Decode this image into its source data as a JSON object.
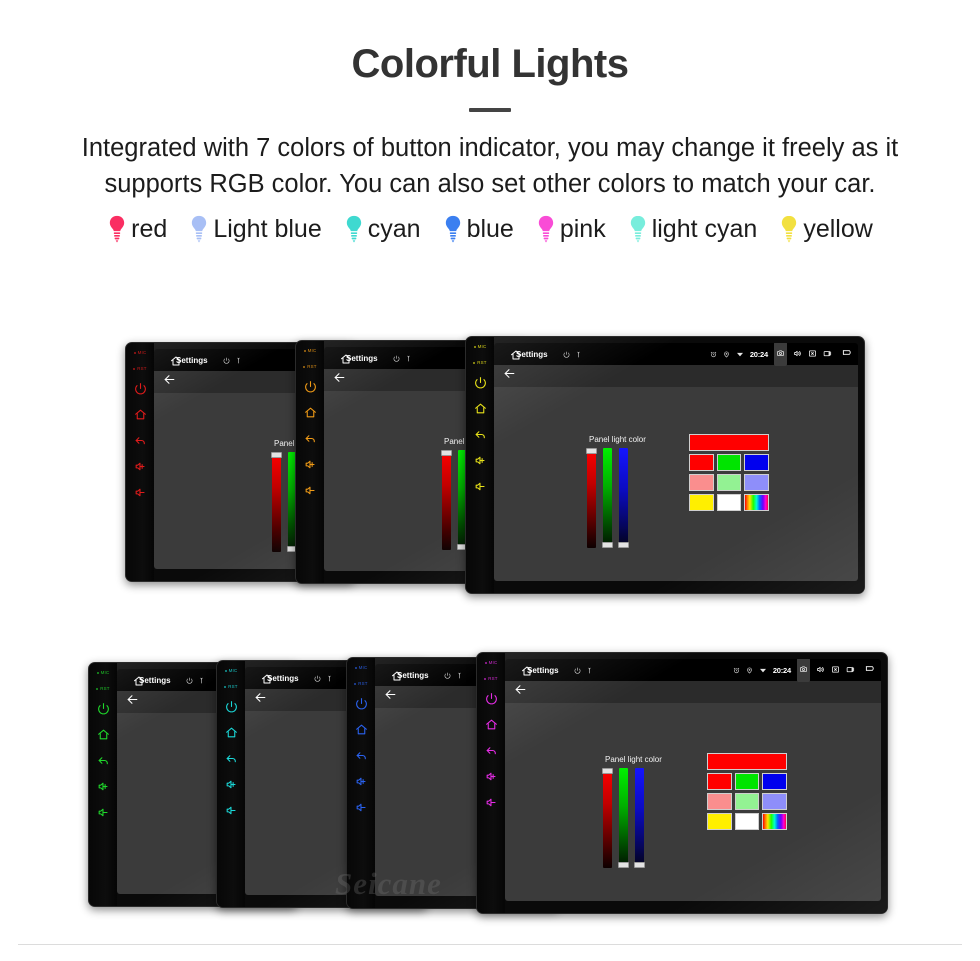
{
  "hero": {
    "title": "Colorful Lights",
    "description": "Integrated with 7 colors of button indicator, you may change it freely as it supports RGB color. You can also set other colors to match your car."
  },
  "legend": {
    "items": [
      {
        "label": "red",
        "color": "#fa2e62"
      },
      {
        "label": "Light blue",
        "color": "#a8bff5"
      },
      {
        "label": "cyan",
        "color": "#3fd9d0"
      },
      {
        "label": "blue",
        "color": "#3b7ff0"
      },
      {
        "label": "pink",
        "color": "#f94cd6"
      },
      {
        "label": "light cyan",
        "color": "#78eddc"
      },
      {
        "label": "yellow",
        "color": "#f2e040"
      }
    ]
  },
  "unit_ui": {
    "title": "Settings",
    "panel_label_full": "Panel light color",
    "panel_label_clipped_long": "Panel light",
    "panel_label_clipped_mid": "Panel ligh",
    "panel_label_clipped_short": "Panel",
    "clock": "20:24",
    "rail_labels": {
      "mic": "MIC",
      "rst": "RST"
    },
    "rail_icons": [
      "power-icon",
      "home-icon",
      "back-icon",
      "volume-up-icon",
      "volume-down-icon"
    ],
    "statusbar_icons": [
      "home-icon",
      "power-small-icon",
      "usb-icon",
      "alarm-icon",
      "location-icon",
      "wifi-icon",
      "screenshot-icon",
      "volume-icon",
      "close-icon",
      "recents-icon",
      "back-nav-icon"
    ],
    "appbar_icon": "back-arrow-icon",
    "swatches": {
      "preview": "#ff0000",
      "rows": [
        [
          "#ff0000",
          "#00e400",
          "#0000ee"
        ],
        [
          "#fa8e8e",
          "#93f293",
          "#8e8efa"
        ],
        [
          "#ffef00",
          "#ffffff",
          "rainbow"
        ]
      ]
    },
    "sliders": [
      {
        "name": "red-slider",
        "channel": "R",
        "thumb": "top"
      },
      {
        "name": "green-slider",
        "channel": "G",
        "thumb": "bottom"
      },
      {
        "name": "blue-slider",
        "channel": "B",
        "thumb": "bottom"
      }
    ]
  },
  "units_top": [
    {
      "rail_color": "#e01b1b",
      "name": "head-unit-red"
    },
    {
      "rail_color": "#ef9a16",
      "name": "head-unit-orange"
    },
    {
      "rail_color": "#e8e219",
      "name": "head-unit-yellow"
    }
  ],
  "units_bottom": [
    {
      "rail_color": "#1fd82b",
      "name": "head-unit-green"
    },
    {
      "rail_color": "#1ad8d8",
      "name": "head-unit-cyan"
    },
    {
      "rail_color": "#2a62f0",
      "name": "head-unit-blue"
    },
    {
      "rail_color": "#e62ce6",
      "name": "head-unit-magenta"
    }
  ],
  "watermark": "Seicane"
}
